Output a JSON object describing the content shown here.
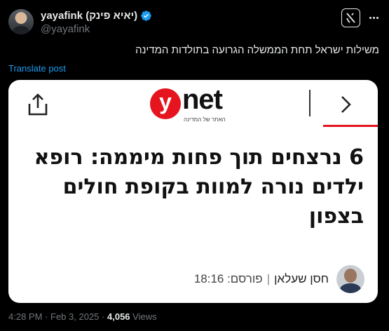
{
  "author": {
    "display_name": "yayafink (יאיא פינק)",
    "handle": "@yayafink",
    "verified_icon": "verified-badge-icon"
  },
  "post": {
    "text": "משילות ישראל תחת הממשלה הגרועה בתולדות המדינה",
    "translate_label": "Translate post"
  },
  "card": {
    "logo_letter": "y",
    "logo_word": "net",
    "logo_tagline": "האתר של המדינה",
    "headline": "6 נרצחים תוך פחות מיממה: רופא ילדים נורה למוות בקופת חולים בצפון",
    "byline_author": "חסן שעלאן",
    "byline_separator": "|",
    "byline_published": "פורסם: 18:16",
    "accent_color": "#e5141e"
  },
  "meta": {
    "time": "4:28 PM",
    "dot": "·",
    "date": "Feb 3, 2025",
    "views_count": "4,056",
    "views_label": "Views"
  }
}
